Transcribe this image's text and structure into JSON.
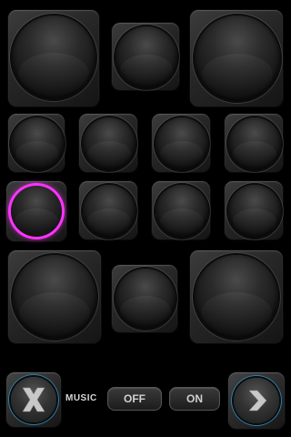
{
  "sound_pads": {
    "row1": [
      "pad-1",
      "pad-2",
      "pad-3"
    ],
    "row2": [
      "pad-4",
      "pad-5",
      "pad-6",
      "pad-7"
    ],
    "row3": [
      "pad-8",
      "pad-9",
      "pad-10",
      "pad-11"
    ],
    "row4": [
      "pad-12",
      "pad-13",
      "pad-14"
    ],
    "active_pad": "pad-8",
    "active_color": "#ff33ff"
  },
  "controls": {
    "close_icon": "x-icon",
    "music_label": "MUSIC",
    "off_label": "OFF",
    "on_label": "ON",
    "next_icon": "chevron-right-icon",
    "ring_color": "#2f7ea6"
  }
}
